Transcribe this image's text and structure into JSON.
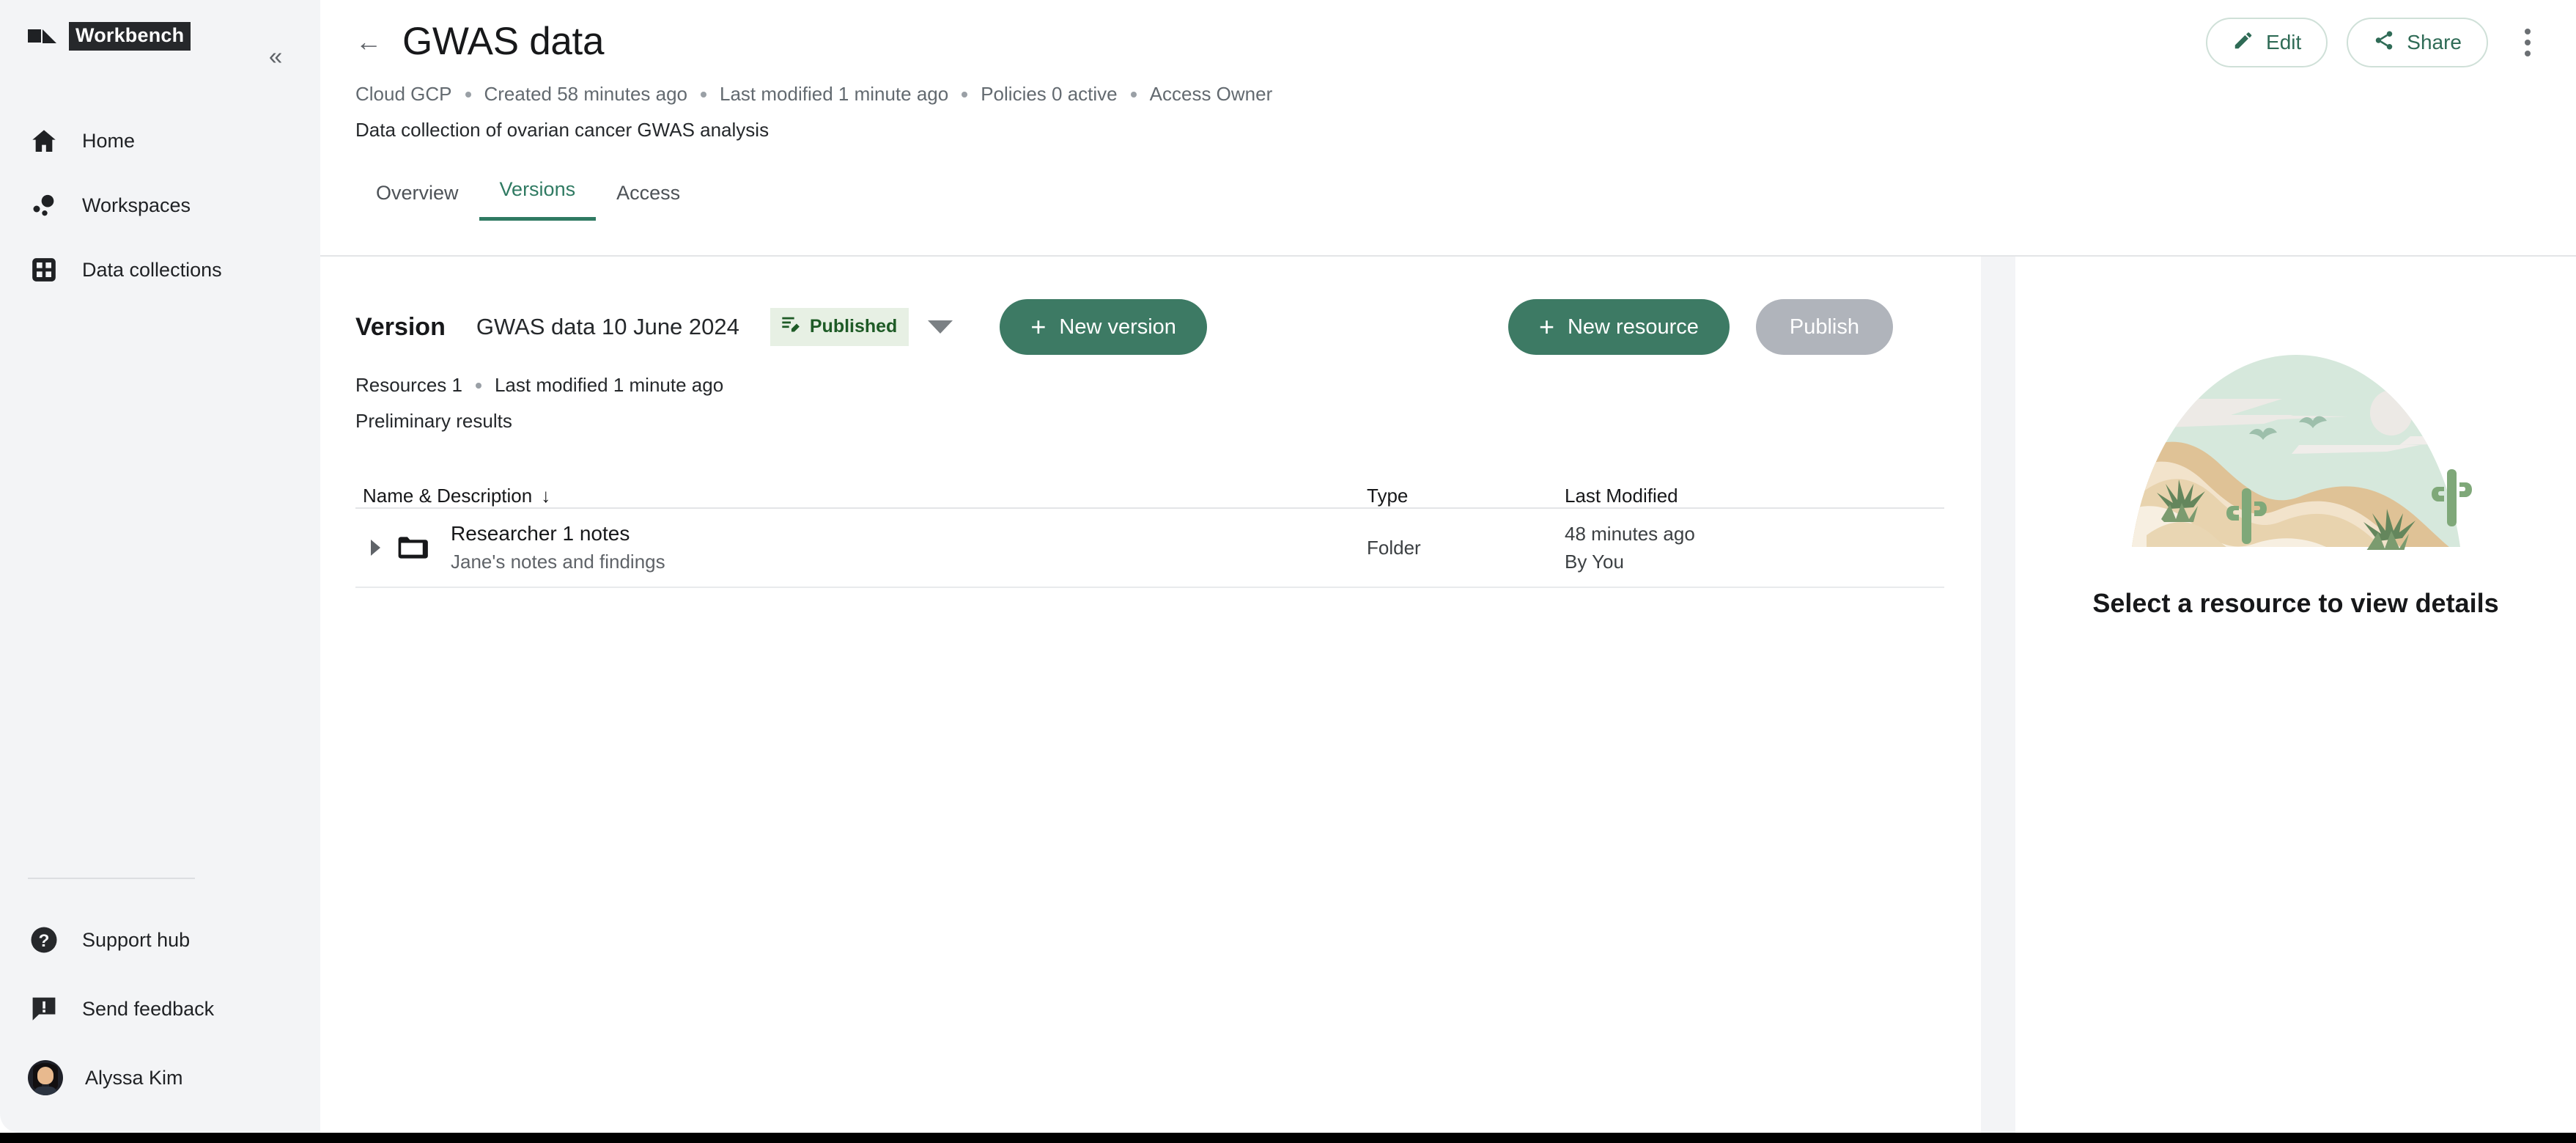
{
  "sidebar": {
    "brand": "Workbench",
    "collapse_glyph": "«",
    "nav_items": [
      {
        "label": "Home",
        "icon": "home-icon"
      },
      {
        "label": "Workspaces",
        "icon": "workspaces-icon"
      },
      {
        "label": "Data collections",
        "icon": "grid-icon"
      }
    ],
    "footer_items": [
      {
        "label": "Support hub",
        "icon": "help-icon"
      },
      {
        "label": "Send feedback",
        "icon": "feedback-icon"
      }
    ],
    "user": {
      "name": "Alyssa Kim"
    }
  },
  "header": {
    "back_glyph": "←",
    "title": "GWAS data",
    "edit_label": "Edit",
    "share_label": "Share",
    "meta": [
      "Cloud GCP",
      "Created 58 minutes ago",
      "Last modified 1 minute ago",
      "Policies 0 active",
      "Access Owner"
    ],
    "description": "Data collection of ovarian cancer GWAS analysis",
    "tabs": [
      {
        "label": "Overview",
        "active": false
      },
      {
        "label": "Versions",
        "active": true
      },
      {
        "label": "Access",
        "active": false
      }
    ]
  },
  "version": {
    "label": "Version",
    "name": "GWAS data 10 June 2024",
    "status": "Published",
    "new_version_label": "New version",
    "new_resource_label": "New resource",
    "publish_label": "Publish",
    "plus_glyph": "+",
    "resources_text": "Resources 1",
    "last_modified_text": "Last modified 1 minute ago",
    "description": "Preliminary results"
  },
  "table": {
    "columns": [
      {
        "label": "Name & Description",
        "sort_glyph": "↓"
      },
      {
        "label": "Type"
      },
      {
        "label": "Last Modified"
      }
    ],
    "rows": [
      {
        "name": "Researcher 1 notes",
        "description": "Jane's notes and findings",
        "type": "Folder",
        "modified": "48 minutes ago",
        "modified_by": "By You"
      }
    ]
  },
  "detail_pane": {
    "empty_text": "Select a resource to view details",
    "illustration": "desert-landscape-illustration"
  },
  "colors": {
    "accent_green": "#3d7a64",
    "accent_text_green": "#2f6b56",
    "badge_bg": "#e7f0e4",
    "badge_text": "#1e5b26",
    "disabled_gray": "#b0b4bb",
    "sidebar_bg": "#f3f4f6"
  }
}
